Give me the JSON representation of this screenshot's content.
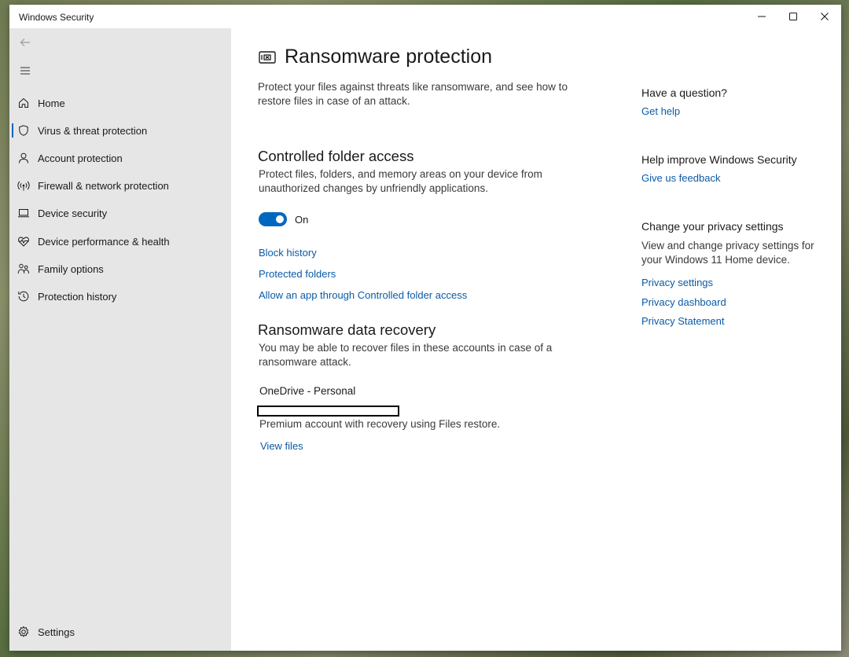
{
  "window": {
    "title": "Windows Security"
  },
  "sidebar": {
    "items": [
      {
        "label": "Home",
        "icon": "home-icon"
      },
      {
        "label": "Virus & threat protection",
        "icon": "shield-icon",
        "active": true
      },
      {
        "label": "Account protection",
        "icon": "person-icon"
      },
      {
        "label": "Firewall & network protection",
        "icon": "wifi-antenna-icon"
      },
      {
        "label": "Device security",
        "icon": "laptop-icon"
      },
      {
        "label": "Device performance & health",
        "icon": "heart-pulse-icon"
      },
      {
        "label": "Family options",
        "icon": "family-icon"
      },
      {
        "label": "Protection history",
        "icon": "history-icon"
      }
    ],
    "settings_label": "Settings"
  },
  "main": {
    "title": "Ransomware protection",
    "intro": "Protect your files against threats like ransomware, and see how to restore files in case of an attack.",
    "cfa": {
      "heading": "Controlled folder access",
      "description": "Protect files, folders, and memory areas on your device from unauthorized changes by unfriendly applications.",
      "toggle_state": "On",
      "links": [
        "Block history",
        "Protected folders",
        "Allow an app through Controlled folder access"
      ]
    },
    "recovery": {
      "heading": "Ransomware data recovery",
      "description": "You may be able to recover files in these accounts in case of a ransomware attack.",
      "account_name": "OneDrive - Personal",
      "account_detail": "Premium account with recovery using Files restore.",
      "view_files": "View files"
    }
  },
  "aside": {
    "question_heading": "Have a question?",
    "get_help": "Get help",
    "improve_heading": "Help improve Windows Security",
    "feedback": "Give us feedback",
    "privacy_heading": "Change your privacy settings",
    "privacy_description": "View and change privacy settings for your Windows 11 Home device.",
    "privacy_links": [
      "Privacy settings",
      "Privacy dashboard",
      "Privacy Statement"
    ]
  },
  "colors": {
    "accent": "#0067c0",
    "link": "#0a5aa6",
    "sidebar_bg": "#e6e6e6"
  }
}
